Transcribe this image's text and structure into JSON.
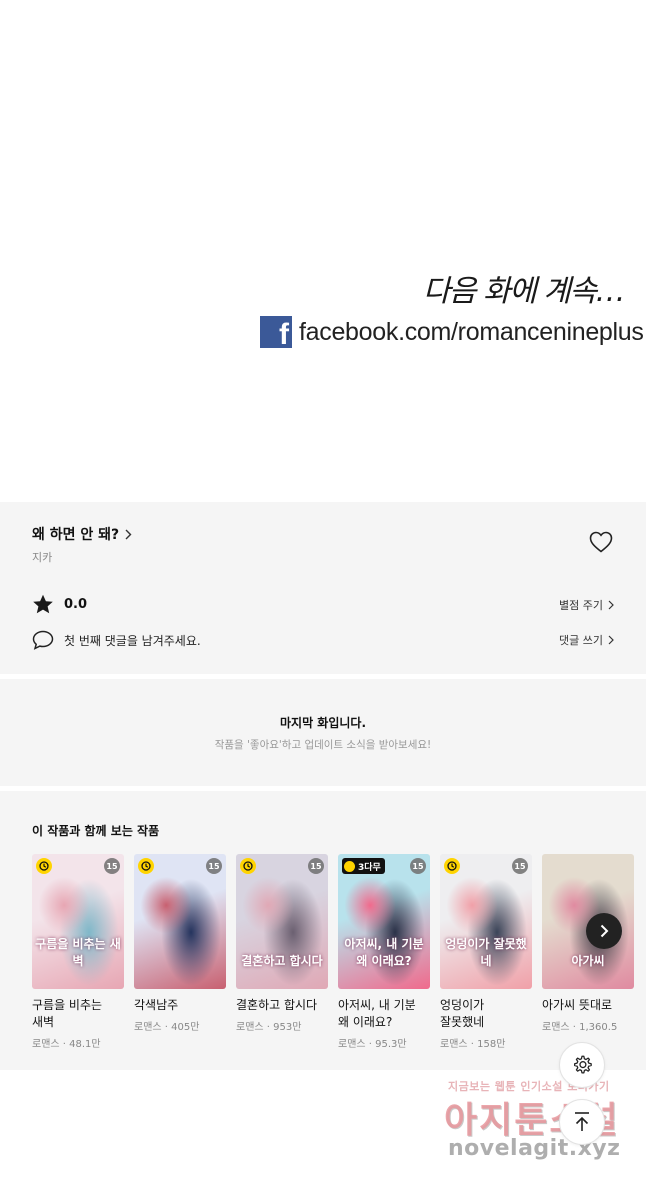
{
  "comic": {
    "next_text": "다음 화에 계속…",
    "facebook_url": "facebook.com/romancenineplus"
  },
  "info": {
    "title": "왜 하면 안 돼?",
    "author": "지카",
    "rating": "0.0",
    "rate_action": "별점 주기",
    "comment_prompt": "첫 번째 댓글을 남겨주세요.",
    "comment_action": "댓글 쓰기"
  },
  "last_episode": {
    "title": "마지막 화입니다.",
    "subtitle": "작품을 '좋아요'하고 업데이트 소식을 받아보세요!"
  },
  "recommendations": {
    "heading": "이 작품과 함께 보는 작품",
    "items": [
      {
        "title": "구름을 비추는 새벽",
        "meta": "로맨스 · 48.1만",
        "badge": "clock",
        "age": "15",
        "cover_text": "구름을 비추는 새벽",
        "colors": [
          "#f3e4ea",
          "#7fb8c9",
          "#e7a6b3"
        ]
      },
      {
        "title": "각색남주",
        "meta": "로맨스 · 405만",
        "badge": "clock",
        "age": "15",
        "cover_text": "",
        "colors": [
          "#dfe4f4",
          "#25345e",
          "#c86070"
        ]
      },
      {
        "title": "결혼하고 합시다",
        "meta": "로맨스 · 953만",
        "badge": "clock",
        "age": "15",
        "cover_text": "결혼하고 합시다",
        "colors": [
          "#d8d4e0",
          "#6b6071",
          "#e0a8b5"
        ]
      },
      {
        "title": "아저씨, 내 기분 왜 이래요?",
        "meta": "로맨스 · 95.3만",
        "badge": "3다무",
        "age": "15",
        "cover_text": "아저씨, 내 기분 왜 이래요?",
        "colors": [
          "#b8e2ec",
          "#2a3248",
          "#f06a8c"
        ]
      },
      {
        "title": "엉덩이가 잘못했네",
        "meta": "로맨스 · 158만",
        "badge": "clock",
        "age": "15",
        "cover_text": "엉덩이가 잘못했네",
        "colors": [
          "#eeeef0",
          "#3a4458",
          "#f0a0a8"
        ]
      },
      {
        "title": "아가씨 뜻대로",
        "meta": "로맨스 · 1,360.5",
        "badge": "",
        "age": "",
        "cover_text": "아가씨",
        "colors": [
          "#e4dccf",
          "#3d3a44",
          "#e08aa0"
        ]
      }
    ]
  },
  "watermark": {
    "line1": "지금보는 웹툰 인기소설 보러가기",
    "line2": "아지툰소설",
    "line3": "novelagit.xyz"
  },
  "colors": {
    "facebook_blue": "#3b5998",
    "section_bg": "#f5f5f5",
    "clock_badge": "#ffd400"
  }
}
